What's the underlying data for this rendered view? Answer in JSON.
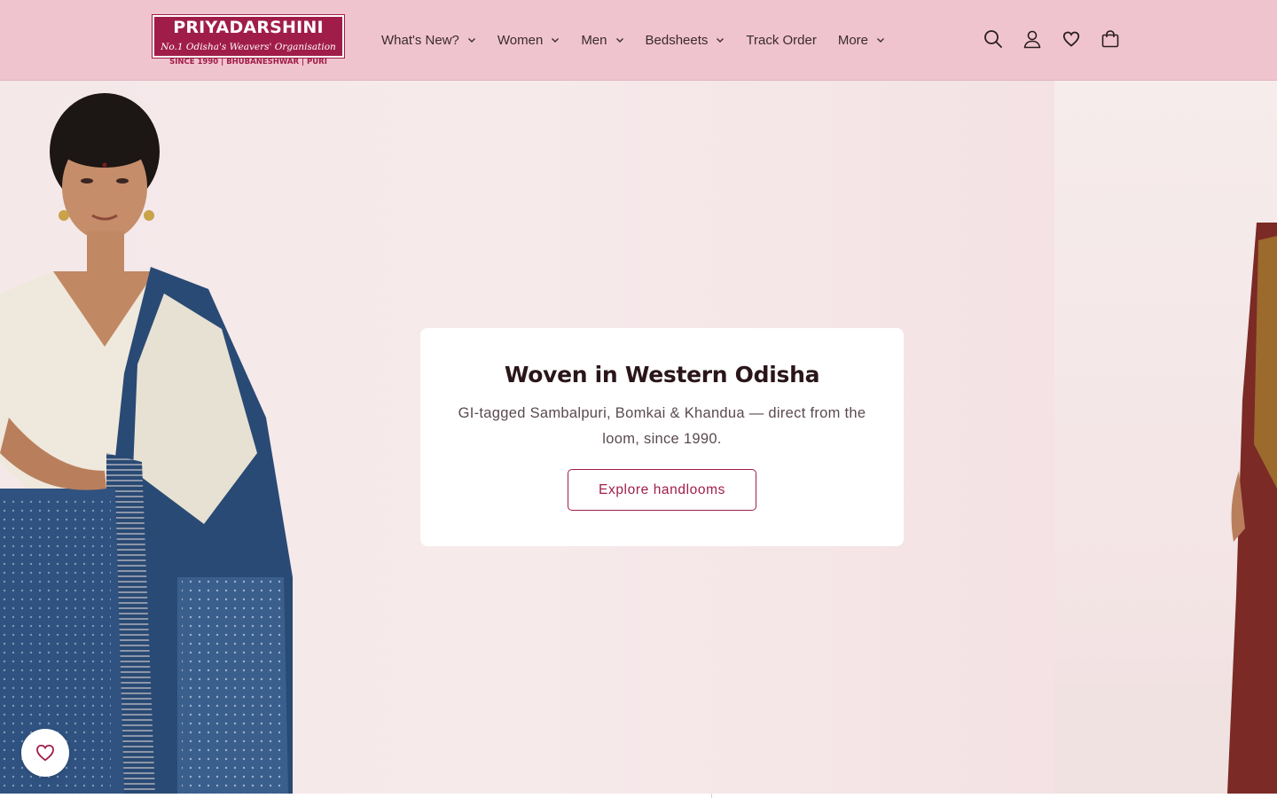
{
  "brand": {
    "name": "PRIYADARSHINI",
    "tagline": "No.1 Odisha's Weavers' Organisation",
    "since": "SINCE 1990 | BHUBANESHWAR | PURI",
    "accent": "#a11d49",
    "header_bg": "#f0c4cf"
  },
  "nav": {
    "items": [
      {
        "label": "What's New?",
        "has_dropdown": true
      },
      {
        "label": "Women",
        "has_dropdown": true
      },
      {
        "label": "Men",
        "has_dropdown": true
      },
      {
        "label": "Bedsheets",
        "has_dropdown": true
      },
      {
        "label": "Track Order",
        "has_dropdown": false
      },
      {
        "label": "More",
        "has_dropdown": true
      }
    ]
  },
  "header_icons": [
    "search-icon",
    "account-icon",
    "wishlist-heart-icon",
    "cart-bag-icon"
  ],
  "hero": {
    "title": "Woven in Western Odisha",
    "text": "GI-tagged Sambalpuri, Bomkai & Khandua — direct from the loom, since 1990.",
    "button_label": "Explore handlooms"
  },
  "floating": {
    "wishlist_icon": "heart-icon"
  }
}
